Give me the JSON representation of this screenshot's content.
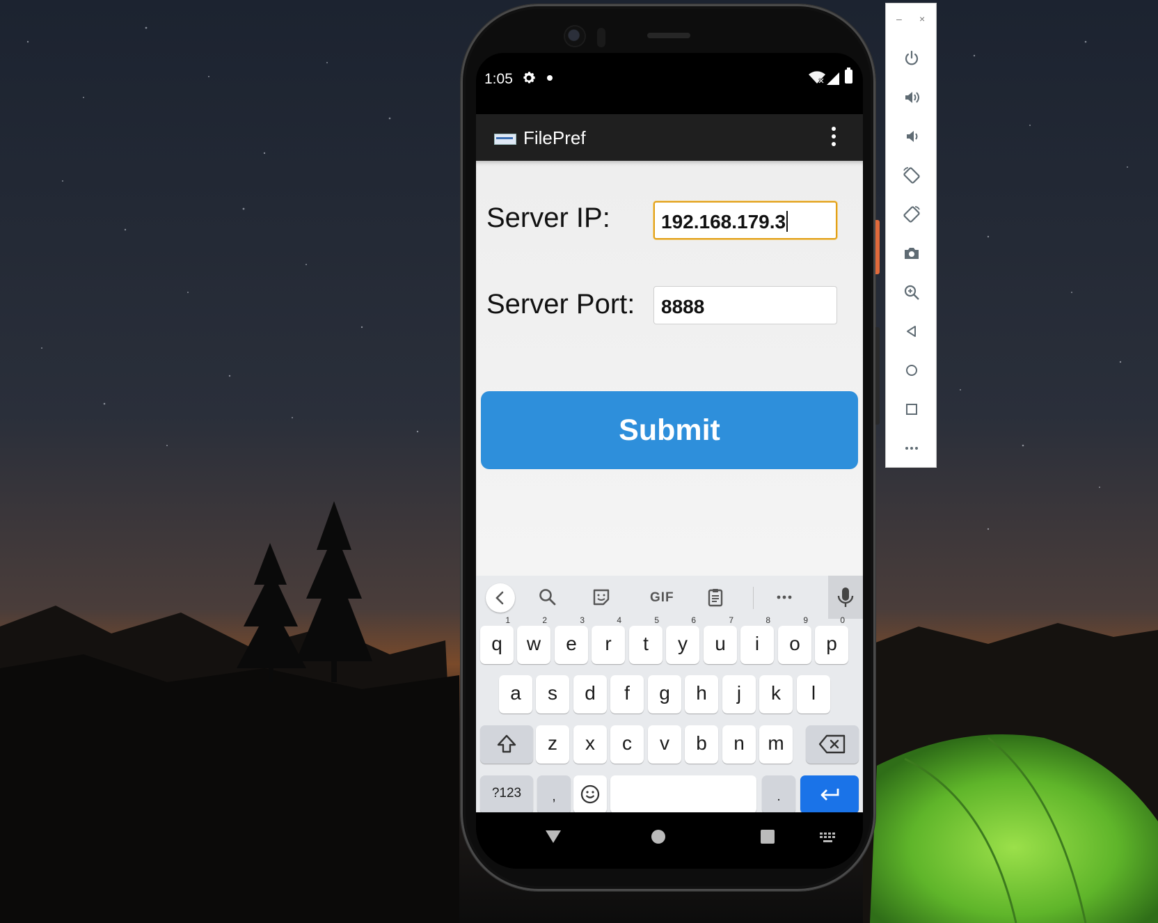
{
  "status_bar": {
    "time": "1:05",
    "icons": [
      "settings-icon",
      "notification-dot",
      "wifi-icon",
      "cell-signal-icon",
      "battery-icon"
    ]
  },
  "app_bar": {
    "title": "FilePref",
    "overflow_menu_icon": "more-vert-icon"
  },
  "form": {
    "server_ip": {
      "label": "Server IP:",
      "value": "192.168.179.3",
      "focused": true
    },
    "server_port": {
      "label": "Server Port:",
      "value": "8888"
    },
    "submit_label": "Submit"
  },
  "keyboard": {
    "suggestion_strip": [
      "back-icon",
      "search-icon",
      "sticker-icon",
      "GIF",
      "clipboard-icon",
      "more-icon",
      "mic-icon"
    ],
    "rows": [
      [
        {
          "k": "q",
          "h": "1"
        },
        {
          "k": "w",
          "h": "2"
        },
        {
          "k": "e",
          "h": "3"
        },
        {
          "k": "r",
          "h": "4"
        },
        {
          "k": "t",
          "h": "5"
        },
        {
          "k": "y",
          "h": "6"
        },
        {
          "k": "u",
          "h": "7"
        },
        {
          "k": "i",
          "h": "8"
        },
        {
          "k": "o",
          "h": "9"
        },
        {
          "k": "p",
          "h": "0"
        }
      ],
      [
        "a",
        "s",
        "d",
        "f",
        "g",
        "h",
        "j",
        "k",
        "l"
      ],
      [
        "z",
        "x",
        "c",
        "v",
        "b",
        "n",
        "m"
      ]
    ],
    "bottom_row": {
      "symbols": "?123",
      "comma": ",",
      "period": "."
    }
  },
  "colors": {
    "accent_button": "#2e8fdb",
    "focus_border": "#e2a018",
    "enter_key": "#1a73e8",
    "app_bar": "#1f1f1f"
  },
  "emulator_toolbar": {
    "window_controls": [
      "minimize-icon",
      "close-icon"
    ],
    "buttons": [
      "power-icon",
      "volume-up-icon",
      "volume-down-icon",
      "rotate-left-icon",
      "rotate-right-icon",
      "screenshot-icon",
      "zoom-icon",
      "back-icon",
      "home-icon",
      "overview-icon",
      "more-icon"
    ]
  }
}
